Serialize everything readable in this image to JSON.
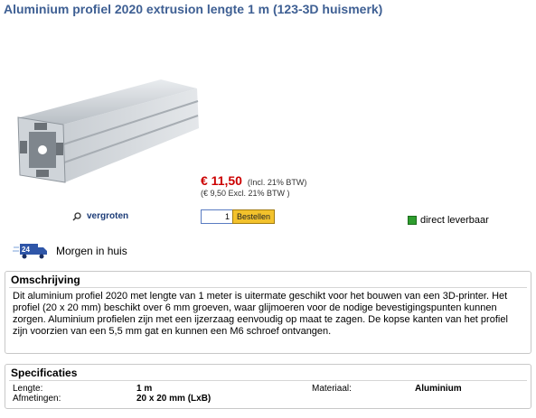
{
  "product": {
    "title": "Aluminium profiel 2020 extrusion lengte 1 m (123-3D huismerk)"
  },
  "image": {
    "zoom_label": "vergroten",
    "zoom_icon": "magnifier-icon"
  },
  "price": {
    "amount": "€ 11,50",
    "incl_note": "(Incl. 21% BTW)",
    "excl_note": "(€ 9,50 Excl. 21% BTW )"
  },
  "order": {
    "quantity": "1",
    "button_label": "Bestellen"
  },
  "stock": {
    "label": "direct leverbaar",
    "status_color": "#2e9d2e"
  },
  "delivery": {
    "label": "Morgen in huis",
    "icon": "delivery-truck-24h-icon"
  },
  "description": {
    "heading": "Omschrijving",
    "text": "Dit aluminium profiel 2020 met lengte van 1 meter is uitermate geschikt voor het bouwen van een 3D-printer. Het profiel (20 x 20 mm) beschikt over 6 mm groeven, waar glijmoeren voor de nodige bevestigingspunten kunnen zorgen. Aluminium profielen zijn met een ijzerzaag eenvoudig op maat te zagen. De kopse kanten van het profiel zijn voorzien van een 5,5 mm gat en kunnen een M6 schroef ontvangen."
  },
  "specs": {
    "heading": "Specificaties",
    "rows": [
      {
        "k1": "Lengte:",
        "v1": "1 m",
        "k2": "Materiaal:",
        "v2": "Aluminium"
      },
      {
        "k1": "Afmetingen:",
        "v1": "20 x 20 mm (LxB)",
        "k2": "",
        "v2": ""
      }
    ]
  },
  "colors": {
    "title": "#3e5f93",
    "price": "#cc0000",
    "button": "#f3c22c"
  }
}
